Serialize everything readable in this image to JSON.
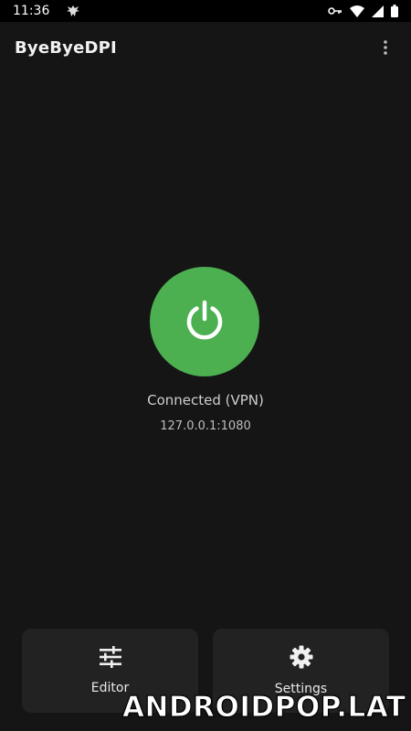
{
  "status_bar": {
    "time": "11:36",
    "icons": [
      "notification-bird-icon",
      "vpn-key-icon",
      "wifi-icon",
      "signal-icon",
      "battery-icon"
    ]
  },
  "app_bar": {
    "title": "ByeByeDPI",
    "overflow_icon": "more-vert-icon"
  },
  "main": {
    "power_button": {
      "icon": "power-icon",
      "state": "connected",
      "color": "#4caf50"
    },
    "status": "Connected (VPN)",
    "address": "127.0.0.1:1080"
  },
  "bottom_bar": {
    "editor": {
      "label": "Editor",
      "icon": "tune-icon"
    },
    "settings": {
      "label": "Settings",
      "icon": "gear-icon"
    }
  },
  "watermark": "ANDROIDPOP.LAT"
}
